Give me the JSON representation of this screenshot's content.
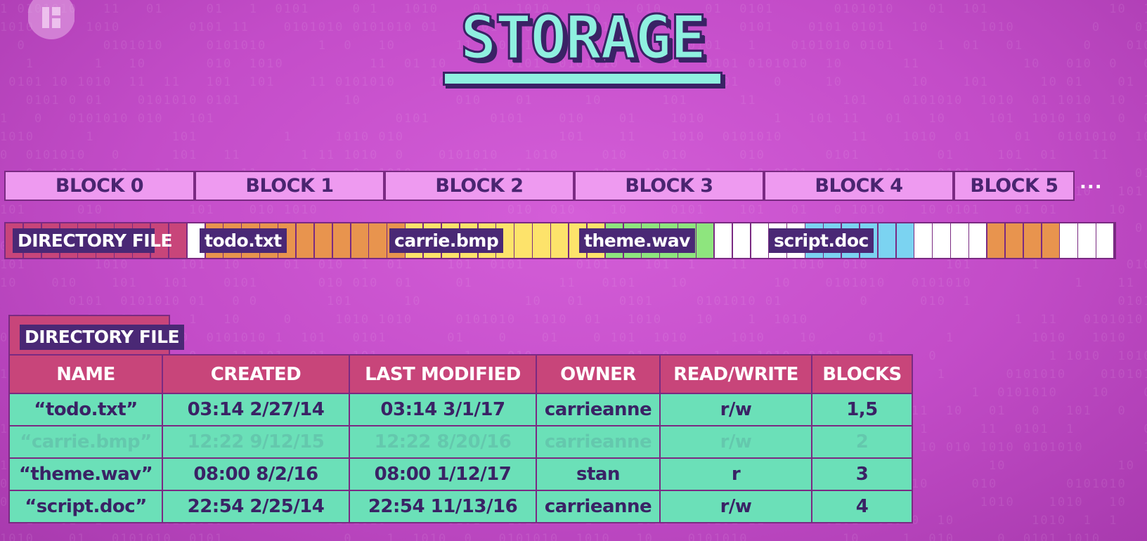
{
  "title": "STORAGE",
  "colors": {
    "background": "#c34cc8",
    "block_header": "#ee9af0",
    "directory": "#c8457a",
    "todo": "#e8944e",
    "carrie": "#fde36b",
    "theme": "#8ee57e",
    "script": "#7bd3f1",
    "empty": "#ffffff",
    "table_body": "#6be0b8",
    "label": "#4a2875"
  },
  "blocks": [
    "BLOCK 0",
    "BLOCK 1",
    "BLOCK 2",
    "BLOCK 3",
    "BLOCK 4",
    "BLOCK 5"
  ],
  "block_ellipsis": "...",
  "strip": {
    "labels": {
      "directory": "DIRECTORY FILE",
      "todo": "todo.txt",
      "carrie": "carrie.bmp",
      "theme": "theme.wav",
      "script": "script.doc"
    },
    "ellipsis": "..."
  },
  "directory_table": {
    "tag": "DIRECTORY FILE",
    "headers": [
      "NAME",
      "CREATED",
      "LAST MODIFIED",
      "OWNER",
      "READ/WRITE",
      "BLOCKS"
    ],
    "rows": [
      [
        "“todo.txt”",
        "03:14 2/27/14",
        "03:14 3/1/17",
        "carrieanne",
        "r/w",
        "1,5"
      ],
      [
        "“carrie.bmp”",
        "12:22 9/12/15",
        "12:22 8/20/16",
        "carrieanne",
        "r/w",
        "2"
      ],
      [
        "“theme.wav”",
        "08:00 8/2/16",
        "08:00 1/12/17",
        "stan",
        "r",
        "3"
      ],
      [
        "“script.doc”",
        "22:54 2/25/14",
        "22:54 11/13/16",
        "carrieanne",
        "r/w",
        "4"
      ]
    ]
  }
}
